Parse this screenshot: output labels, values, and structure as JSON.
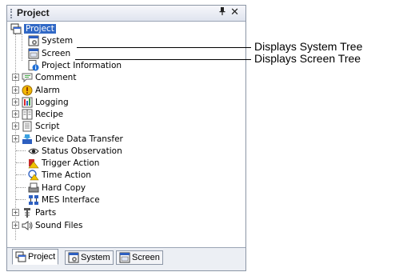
{
  "panel": {
    "title": "Project",
    "pin_glyph": "p",
    "close_glyph": "✕"
  },
  "tree": {
    "root": "Project",
    "children_system_screen": [
      "System",
      "Screen"
    ],
    "items": [
      {
        "label": "Project Information",
        "expandable": false
      },
      {
        "label": "Comment",
        "expandable": true
      },
      {
        "label": "Alarm",
        "expandable": true
      },
      {
        "label": "Logging",
        "expandable": true
      },
      {
        "label": "Recipe",
        "expandable": true
      },
      {
        "label": "Script",
        "expandable": true
      },
      {
        "label": "Device Data Transfer",
        "expandable": true
      },
      {
        "label": "Status Observation",
        "expandable": false
      },
      {
        "label": "Trigger Action",
        "expandable": false
      },
      {
        "label": "Time Action",
        "expandable": false
      },
      {
        "label": "Hard Copy",
        "expandable": false
      },
      {
        "label": "MES Interface",
        "expandable": false
      },
      {
        "label": "Parts",
        "expandable": true
      },
      {
        "label": "Sound Files",
        "expandable": true
      }
    ]
  },
  "tabs": [
    {
      "label": "Project",
      "active": true
    },
    {
      "label": "System",
      "active": false
    },
    {
      "label": "Screen",
      "active": false
    }
  ],
  "callouts": {
    "system": "Displays System Tree",
    "screen": "Displays Screen Tree"
  },
  "colors": {
    "selection": "#3169c6",
    "panel_border": "#8c96a6"
  }
}
